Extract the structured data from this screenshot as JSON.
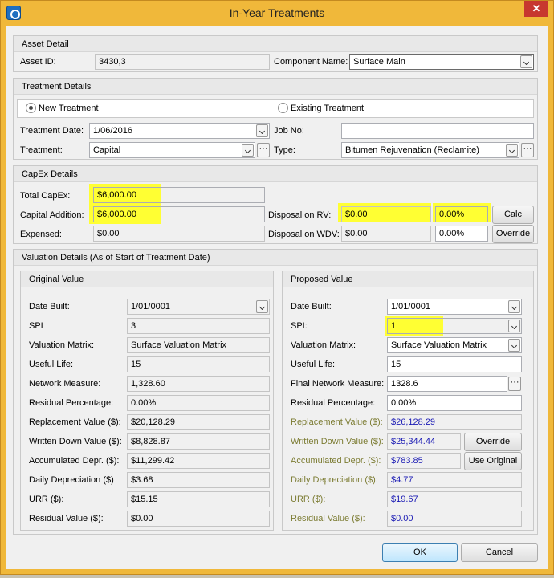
{
  "window": {
    "title": "In-Year Treatments",
    "close_glyph": "✕"
  },
  "asset_detail": {
    "heading": "Asset Detail",
    "asset_id_label": "Asset ID:",
    "asset_id_value": "3430,3",
    "component_label": "Component Name:",
    "component_value": "Surface Main"
  },
  "treatment_details": {
    "heading": "Treatment Details",
    "new_treatment_label": "New Treatment",
    "existing_treatment_label": "Existing Treatment",
    "date_label": "Treatment Date:",
    "date_value": "1/06/2016",
    "job_label": "Job No:",
    "job_value": "",
    "treatment_label": "Treatment:",
    "treatment_value": "Capital",
    "type_label": "Type:",
    "type_value": "Bitumen Rejuvenation (Reclamite)"
  },
  "capex": {
    "heading": "CapEx Details",
    "total_label": "Total CapEx:",
    "total_value": "$6,000.00",
    "addition_label": "Capital Addition:",
    "addition_value": "$6,000.00",
    "expensed_label": "Expensed:",
    "expensed_value": "$0.00",
    "disposal_rv_label": "Disposal on RV:",
    "disposal_rv_value": "$0.00",
    "disposal_rv_pct": "0.00%",
    "disposal_wdv_label": "Disposal on WDV:",
    "disposal_wdv_value": "$0.00",
    "disposal_wdv_pct": "0.00%",
    "calc_button": "Calc",
    "override_button": "Override"
  },
  "valuation": {
    "heading": "Valuation Details (As of Start of Treatment Date)",
    "original": {
      "heading": "Original Value",
      "date_built_label": "Date Built:",
      "date_built_value": "1/01/0001",
      "spi_label": "SPI",
      "spi_value": "3",
      "matrix_label": "Valuation Matrix:",
      "matrix_value": "Surface Valuation Matrix",
      "useful_life_label": "Useful Life:",
      "useful_life_value": "15",
      "network_measure_label": "Network Measure:",
      "network_measure_value": "1,328.60",
      "residual_pct_label": "Residual Percentage:",
      "residual_pct_value": "0.00%",
      "replacement_label": "Replacement Value ($):",
      "replacement_value": "$20,128.29",
      "wdv_label": "Written Down Value ($):",
      "wdv_value": "$8,828.87",
      "accum_label": "Accumulated Depr. ($):",
      "accum_value": "$11,299.42",
      "daily_label": "Daily Depreciation ($)",
      "daily_value": "$3.68",
      "urr_label": "URR ($):",
      "urr_value": "$15.15",
      "residual_value_label": "Residual Value ($):",
      "residual_value_value": "$0.00"
    },
    "proposed": {
      "heading": "Proposed Value",
      "date_built_label": "Date Built:",
      "date_built_value": "1/01/0001",
      "spi_label": "SPI:",
      "spi_value": "1",
      "matrix_label": "Valuation Matrix:",
      "matrix_value": "Surface Valuation Matrix",
      "useful_life_label": "Useful Life:",
      "useful_life_value": "15",
      "network_measure_label": "Final Network Measure:",
      "network_measure_value": "1328.6",
      "residual_pct_label": "Residual Percentage:",
      "residual_pct_value": "0.00%",
      "replacement_label": "Replacement Value ($):",
      "replacement_value": "$26,128.29",
      "wdv_label": "Written Down Value ($):",
      "wdv_value": "$25,344.44",
      "accum_label": "Accumulated Depr. ($):",
      "accum_value": "$783.85",
      "daily_label": "Daily Depreciation  ($):",
      "daily_value": "$4.77",
      "urr_label": "URR ($):",
      "urr_value": "$19.67",
      "residual_value_label": "Residual Value ($):",
      "residual_value_value": "$0.00",
      "override_button": "Override",
      "use_original_button": "Use Original"
    }
  },
  "footer": {
    "ok_button": "OK",
    "cancel_button": "Cancel"
  },
  "colors": {
    "highlight": "#ffff00",
    "title_bar": "#f0b83a",
    "computed_text": "#1a1ab4",
    "olive_label": "#7c7c33"
  }
}
